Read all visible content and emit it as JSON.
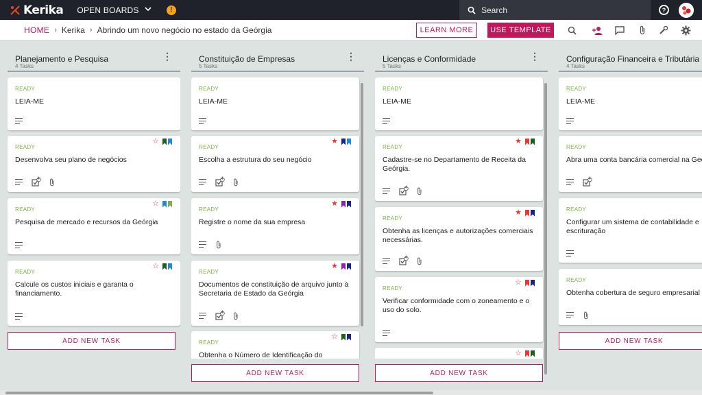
{
  "app": {
    "name": "Kerika",
    "open_boards_label": "OPEN BOARDS",
    "search_placeholder": "Search"
  },
  "breadcrumb": {
    "home": "HOME",
    "account": "Kerika",
    "board": "Abrindo um novo negócio no estado da Geórgia"
  },
  "actions": {
    "learn_more": "LEARN MORE",
    "use_template": "USE TEMPLATE"
  },
  "colors": {
    "brand": "#c2185b",
    "status_ready": "#7cb342",
    "star_red": "#e53935",
    "flag_darkgreen": "#1b5e20",
    "flag_blue": "#1e88e5",
    "flag_green": "#7cb342",
    "flag_purple": "#8e24aa",
    "flag_red": "#e53935",
    "flag_navy": "#1a237e"
  },
  "columns": [
    {
      "title": "Planejamento e Pesquisa",
      "count": "4 Tasks",
      "add_label": "ADD NEW TASK",
      "cards": [
        {
          "status": "READY",
          "title": "LEIA-ME",
          "star": "",
          "flags": [],
          "checklist": "",
          "attachment": false
        },
        {
          "status": "READY",
          "title": "Desenvolva seu plano de negócios",
          "star": "outline",
          "flags": [
            "flag_darkgreen",
            "flag_blue"
          ],
          "checklist": "4",
          "attachment": true
        },
        {
          "status": "READY",
          "title": "Pesquisa de mercado e recursos da Geórgia",
          "star": "outline",
          "flags": [
            "flag_blue",
            "flag_green"
          ],
          "checklist": "",
          "attachment": false
        },
        {
          "status": "READY",
          "title": "Calcule os custos iniciais e garanta o financiamento.",
          "star": "outline",
          "flags": [
            "flag_darkgreen",
            "flag_blue"
          ],
          "checklist": "",
          "attachment": false
        }
      ]
    },
    {
      "title": "Constituição de Empresas",
      "count": "5 Tasks",
      "add_label": "ADD NEW TASK",
      "cards": [
        {
          "status": "READY",
          "title": "LEIA-ME",
          "star": "",
          "flags": [],
          "checklist": "",
          "attachment": false
        },
        {
          "status": "READY",
          "title": "Escolha a estrutura do seu negócio",
          "star": "filled",
          "flags": [
            "flag_navy",
            "flag_blue"
          ],
          "checklist": "4",
          "attachment": true
        },
        {
          "status": "READY",
          "title": "Registre o nome da sua empresa",
          "star": "filled",
          "flags": [
            "flag_purple",
            "flag_navy"
          ],
          "checklist": "",
          "attachment": true
        },
        {
          "status": "READY",
          "title": "Documentos de constituição de arquivo junto à Secretaria de Estado da Geórgia",
          "star": "filled",
          "flags": [
            "flag_purple",
            "flag_navy"
          ],
          "checklist": "4",
          "attachment": true
        },
        {
          "status": "READY",
          "title": "Obtenha o Número de Identificação do",
          "star": "outline",
          "flags": [
            "flag_darkgreen",
            "flag_navy"
          ],
          "checklist": "",
          "attachment": false
        }
      ]
    },
    {
      "title": "Licenças e Conformidade",
      "count": "5 Tasks",
      "add_label": "ADD NEW TASK",
      "cards": [
        {
          "status": "READY",
          "title": "LEIA-ME",
          "star": "",
          "flags": [],
          "checklist": "",
          "attachment": false
        },
        {
          "status": "READY",
          "title": "Cadastre-se no Departamento de Receita da Geórgia.",
          "star": "filled",
          "flags": [
            "flag_red",
            "flag_darkgreen"
          ],
          "checklist": "4",
          "attachment": true
        },
        {
          "status": "READY",
          "title": "Obtenha as licenças e autorizações comerciais necessárias.",
          "star": "filled",
          "flags": [
            "flag_red",
            "flag_navy"
          ],
          "checklist": "4",
          "attachment": true
        },
        {
          "status": "READY",
          "title": "Verificar conformidade com o zoneamento e o uso do solo.",
          "star": "outline",
          "flags": [
            "flag_red",
            "flag_navy"
          ],
          "checklist": "",
          "attachment": false
        },
        {
          "status": "",
          "title": "",
          "star": "outline",
          "flags": [
            "flag_red",
            "flag_darkgreen"
          ],
          "checklist": "",
          "attachment": false
        }
      ]
    },
    {
      "title": "Configuração Financeira e Tributária",
      "count": "4 Tasks",
      "add_label": "ADD NEW TASK",
      "cards": [
        {
          "status": "READY",
          "title": "LEIA-ME",
          "star": "",
          "flags": [],
          "checklist": "",
          "attachment": false
        },
        {
          "status": "READY",
          "title": "Abra uma conta bancária comercial na Geó",
          "star": "",
          "flags": [],
          "checklist": "4",
          "attachment": false
        },
        {
          "status": "READY",
          "title": "Configurar um sistema de contabilidade e escrituração",
          "star": "",
          "flags": [],
          "checklist": "",
          "attachment": false
        },
        {
          "status": "READY",
          "title": "Obtenha cobertura de seguro empresarial",
          "star": "",
          "flags": [],
          "checklist": "",
          "attachment": true
        }
      ]
    }
  ]
}
